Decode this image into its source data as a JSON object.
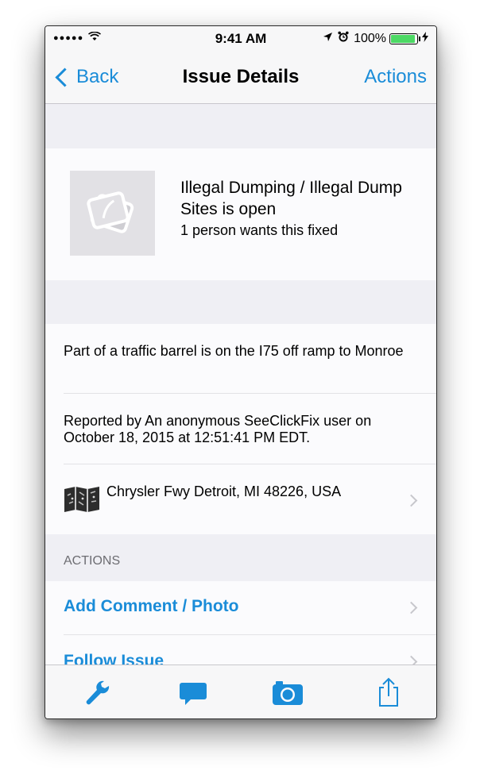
{
  "status_bar": {
    "signal": "●●●●●",
    "wifi": "wifi-icon",
    "time": "9:41 AM",
    "location": "location-arrow-icon",
    "alarm": "alarm-icon",
    "battery_pct": "100%",
    "charging": "charging-icon"
  },
  "nav": {
    "back_label": "Back",
    "title": "Issue Details",
    "actions_label": "Actions"
  },
  "issue": {
    "title": "Illegal Dumping / Illegal Dump Sites is open",
    "subtitle": "1 person wants this fixed"
  },
  "details": {
    "description": "Part of a traffic barrel is on the I75 off ramp to Monroe",
    "reported": "Reported by An anonymous SeeClickFix user on October 18, 2015 at 12:51:41 PM EDT.",
    "address": "Chrysler Fwy Detroit, MI 48226, USA"
  },
  "actions_section": {
    "header": "ACTIONS",
    "items": [
      {
        "label": "Add Comment / Photo"
      },
      {
        "label": "Follow Issue"
      }
    ]
  },
  "tab_bar": {
    "icons": [
      "wrench-icon",
      "comment-icon",
      "camera-icon",
      "share-icon"
    ]
  },
  "colors": {
    "accent": "#1a8cd8",
    "background": "#efeff4",
    "battery": "#4cd964"
  }
}
